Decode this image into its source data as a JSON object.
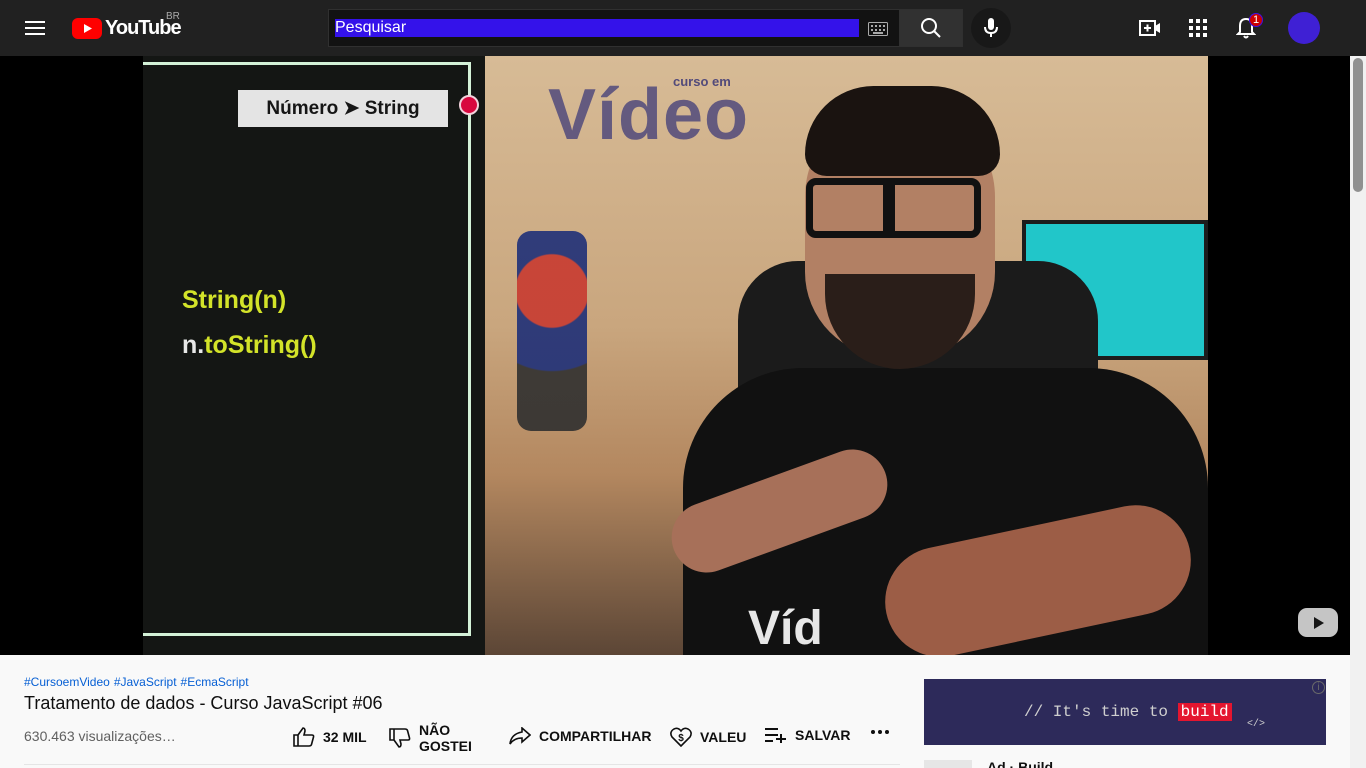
{
  "masthead": {
    "logo_text": "YouTube",
    "country_code": "BR",
    "search_placeholder": "Pesquisar",
    "notification_count": "1",
    "accent_color": "#3412ea"
  },
  "video": {
    "slate_caption": "Número ➤ String",
    "code_line_1": "String(n)",
    "code_line_2_prefix": "n.",
    "code_line_2_method": "toString()",
    "wall_text": "Vídeo",
    "wall_text_small": "curso em",
    "shirt_text": "Víd"
  },
  "info": {
    "hashtags": [
      "#CursoemVideo",
      "#JavaScript",
      "#EcmaScript"
    ],
    "title": "Tratamento de dados - Curso JavaScript #06",
    "views": "630.463 visualizações…",
    "like_count": "32 MIL",
    "dislike_label": "NÃO GOSTEI",
    "share_label": "COMPARTILHAR",
    "thanks_label": "VALEU",
    "save_label": "SALVAR",
    "more_label": "..."
  },
  "ad": {
    "text_prefix": "// It's time to ",
    "text_highlight": "build",
    "tag": "</>",
    "info_symbol": "i",
    "title": "Ad · Build"
  },
  "icons": {
    "menu": "hamburger-icon",
    "search": "search-icon",
    "mic": "mic-icon",
    "create": "create-video-icon",
    "apps": "apps-grid-icon",
    "notifications": "bell-icon"
  }
}
